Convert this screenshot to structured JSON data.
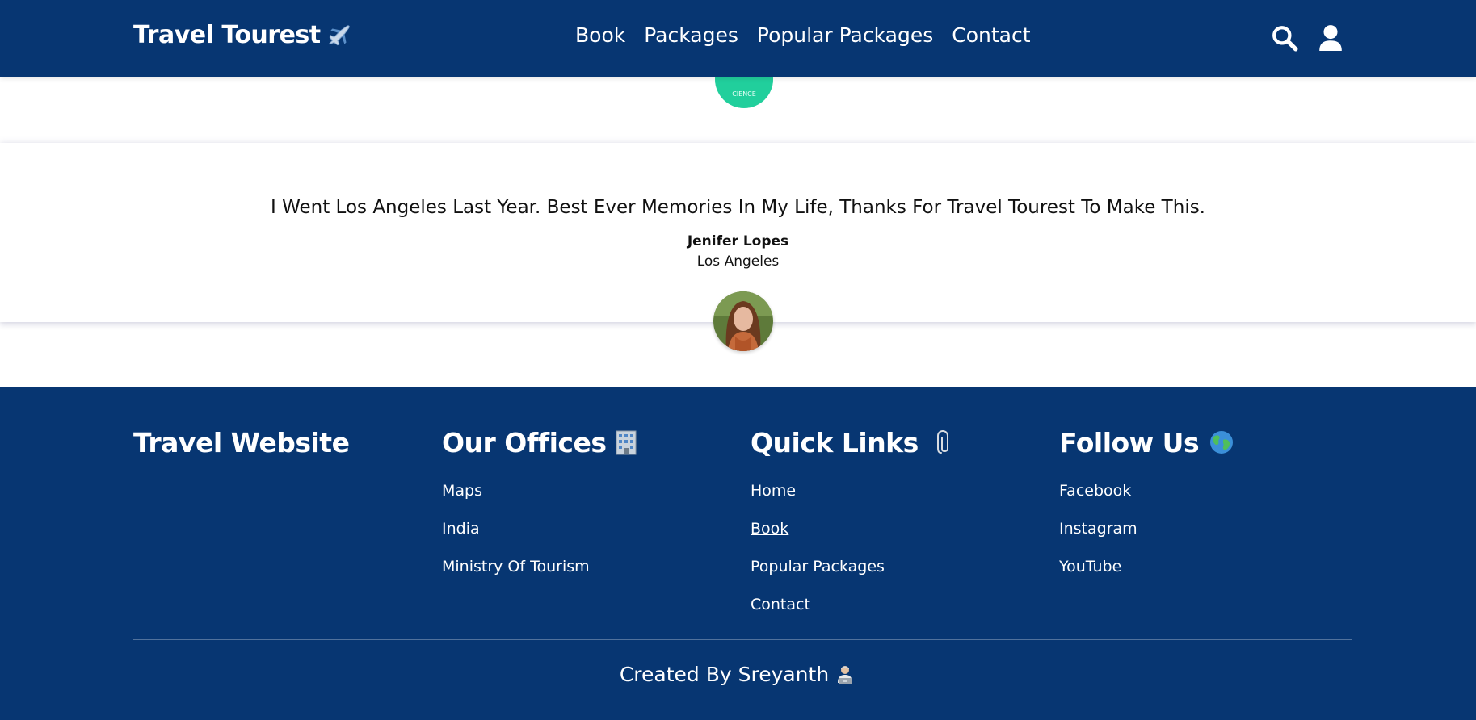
{
  "header": {
    "logo_text": "Travel Tourest",
    "logo_icon": "airplane-icon",
    "nav": [
      {
        "label": "Book"
      },
      {
        "label": "Packages"
      },
      {
        "label": "Popular Packages"
      },
      {
        "label": "Contact"
      }
    ],
    "icons": [
      "search-icon",
      "user-icon"
    ],
    "background": "#073672"
  },
  "testimonial": {
    "quote": "I Went Los Angeles Last Year. Best Ever Memories In My Life, Thanks For Travel Tourest To Make This.",
    "name": "Jenifer Lopes",
    "location": "Los Angeles"
  },
  "footer": {
    "background": "#073672",
    "columns": [
      {
        "title": "Travel Website",
        "icon": "",
        "links": []
      },
      {
        "title": "Our Offices",
        "icon": "office-building-icon",
        "links": [
          {
            "label": "Maps"
          },
          {
            "label": "India"
          },
          {
            "label": "Ministry Of Tourism"
          }
        ]
      },
      {
        "title": "Quick Links",
        "icon": "paperclip-icon",
        "links": [
          {
            "label": "Home"
          },
          {
            "label": "Book"
          },
          {
            "label": "Popular Packages"
          },
          {
            "label": "Contact"
          }
        ]
      },
      {
        "title": "Follow Us",
        "icon": "globe-icon",
        "links": [
          {
            "label": "Facebook"
          },
          {
            "label": "Instagram"
          },
          {
            "label": "YouTube"
          }
        ]
      }
    ],
    "credit": "Created By Sreyanth",
    "credit_icon": "technologist-icon"
  }
}
